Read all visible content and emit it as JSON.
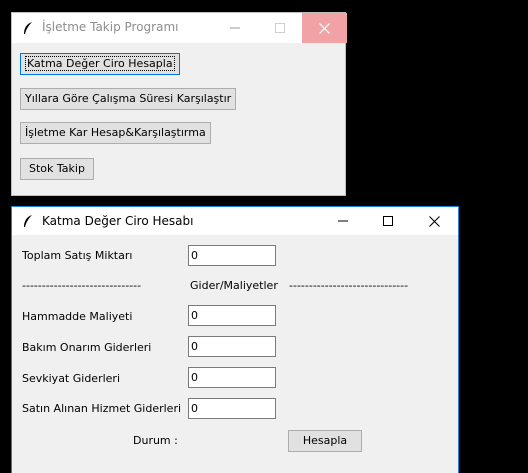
{
  "main_window": {
    "title": "İşletme Takip Programı",
    "buttons": [
      "Katma Değer Ciro Hesapla",
      "Yıllara Göre Çalışma Süresi Karşılaştır",
      "İşletme Kar Hesap&Karşılaştırma",
      "Stok Takip"
    ]
  },
  "calc_window": {
    "title": "Katma Değer Ciro Hesabı",
    "fields": [
      {
        "label": "Toplam Satış Miktarı",
        "value": "0"
      },
      {
        "label": "Hammadde Maliyeti",
        "value": "0"
      },
      {
        "label": "Bakım Onarım Giderleri",
        "value": "0"
      },
      {
        "label": "Sevkiyat Giderleri",
        "value": "0"
      },
      {
        "label": "Satın Alınan Hizmet Giderleri",
        "value": "0"
      }
    ],
    "separator_left": "------------------------------",
    "separator_label": "Gider/Maliyetler",
    "separator_right": "------------------------------",
    "status_label": "Durum :",
    "calculate_button": "Hesapla"
  },
  "colors": {
    "close_inactive_bg": "#f1a2a4",
    "window_bg": "#f0f0f0",
    "focus_border": "#0078d7"
  },
  "icons": {
    "title_icon": "feather-icon",
    "minimize": "minimize-icon",
    "maximize": "maximize-icon",
    "close": "close-icon"
  }
}
